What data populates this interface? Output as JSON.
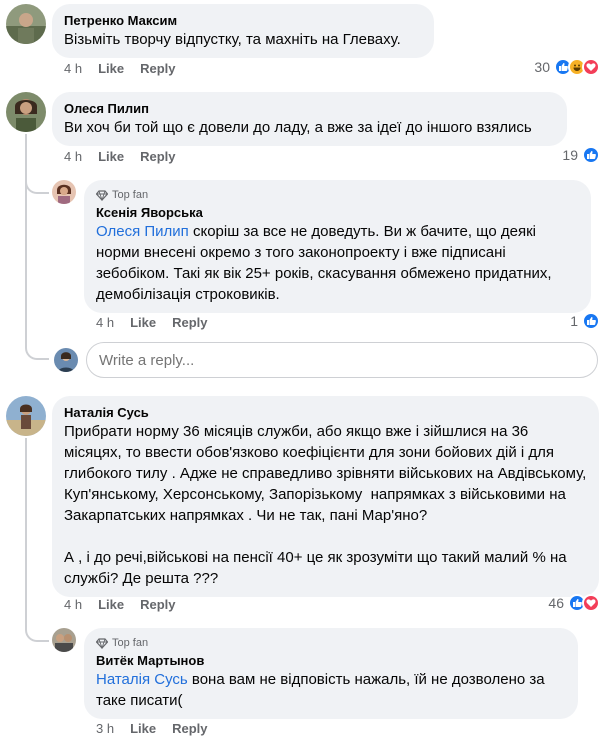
{
  "comments": [
    {
      "author": "Петренко Максим",
      "text": "Візьміть творчу відпустку, та махніть на Глеваху.",
      "time": "4 h",
      "like": "Like",
      "reply": "Reply",
      "reactions": "30",
      "reaction_icons": [
        "like-icon",
        "haha-icon",
        "love-icon"
      ]
    },
    {
      "author": "Олеся Пилип",
      "text": "Ви хоч би той що є довели до ладу, а вже за ідеї до іншого взялись",
      "time": "4 h",
      "like": "Like",
      "reply": "Reply",
      "reactions": "19",
      "reaction_icons": [
        "like-icon"
      ],
      "replies": [
        {
          "badge": "Top fan",
          "author": "Ксенія Яворська",
          "mention": "Олеся Пилип",
          "text": " скоріш за все не доведуть. Ви ж бачите, що деякі норми внесені окремо з того законопроекту і вже підписані зебобіком. Такі як вік 25+ років, скасування обмежено придатних, демобілізація строковиків.",
          "time": "4 h",
          "like": "Like",
          "reply": "Reply",
          "reactions": "1",
          "reaction_icons": [
            "like-icon"
          ]
        }
      ],
      "reply_placeholder": "Write a reply..."
    },
    {
      "author": "Наталія Сусь",
      "text": "Прибрати норму 36 місяців служби, або якщо вже і зійшлися на 36 місяцях, то ввести обов'язково коефіцієнти для зони бойових дій і для глибокого тилу . Адже не справедливо зрівняти військових на Авдівському, Куп'янському, Херсонському, Запорізькому  напрямках з військовими на Закарпатських напрямках . Чи не так, пані Мар'яно?\n\nА , і до речі,військові на пенсії 40+ це як зрозуміти що такий малий % на службі? Де решта ???",
      "time": "4 h",
      "like": "Like",
      "reply": "Reply",
      "reactions": "46",
      "reaction_icons": [
        "like-icon",
        "love-icon"
      ],
      "replies": [
        {
          "badge": "Top fan",
          "author": "Витёк Мартынов",
          "mention": "Наталія Сусь",
          "text": " вона вам не відповість нажаль, їй не дозволено за таке писати(",
          "time": "3 h",
          "like": "Like",
          "reply": "Reply"
        }
      ]
    }
  ],
  "colors": {
    "like": "#1877f2",
    "love": "#f33e58",
    "haha": "#f7b125",
    "mention": "#216fdb"
  }
}
